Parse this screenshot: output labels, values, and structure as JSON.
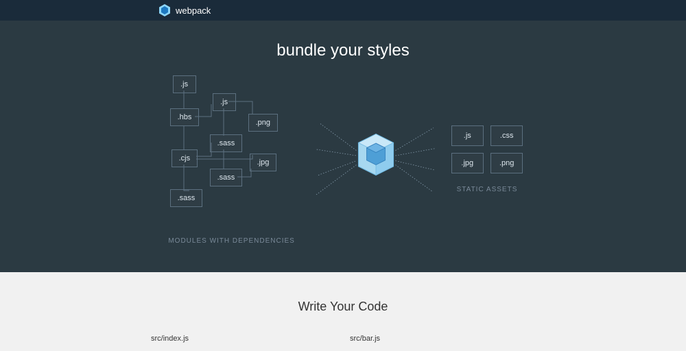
{
  "header": {
    "logo_text": "webpack"
  },
  "hero": {
    "title": "bundle your styles",
    "modules_caption": "MODULES WITH DEPENDENCIES",
    "outputs_caption": "STATIC ASSETS",
    "modules": [
      ".js",
      ".js",
      ".hbs",
      ".png",
      ".sass",
      ".cjs",
      ".jpg",
      ".sass",
      ".sass"
    ],
    "outputs": [
      ".js",
      ".css",
      ".jpg",
      ".png"
    ]
  },
  "section2": {
    "title": "Write Your Code",
    "file1": "src/index.js",
    "file2": "src/bar.js"
  }
}
